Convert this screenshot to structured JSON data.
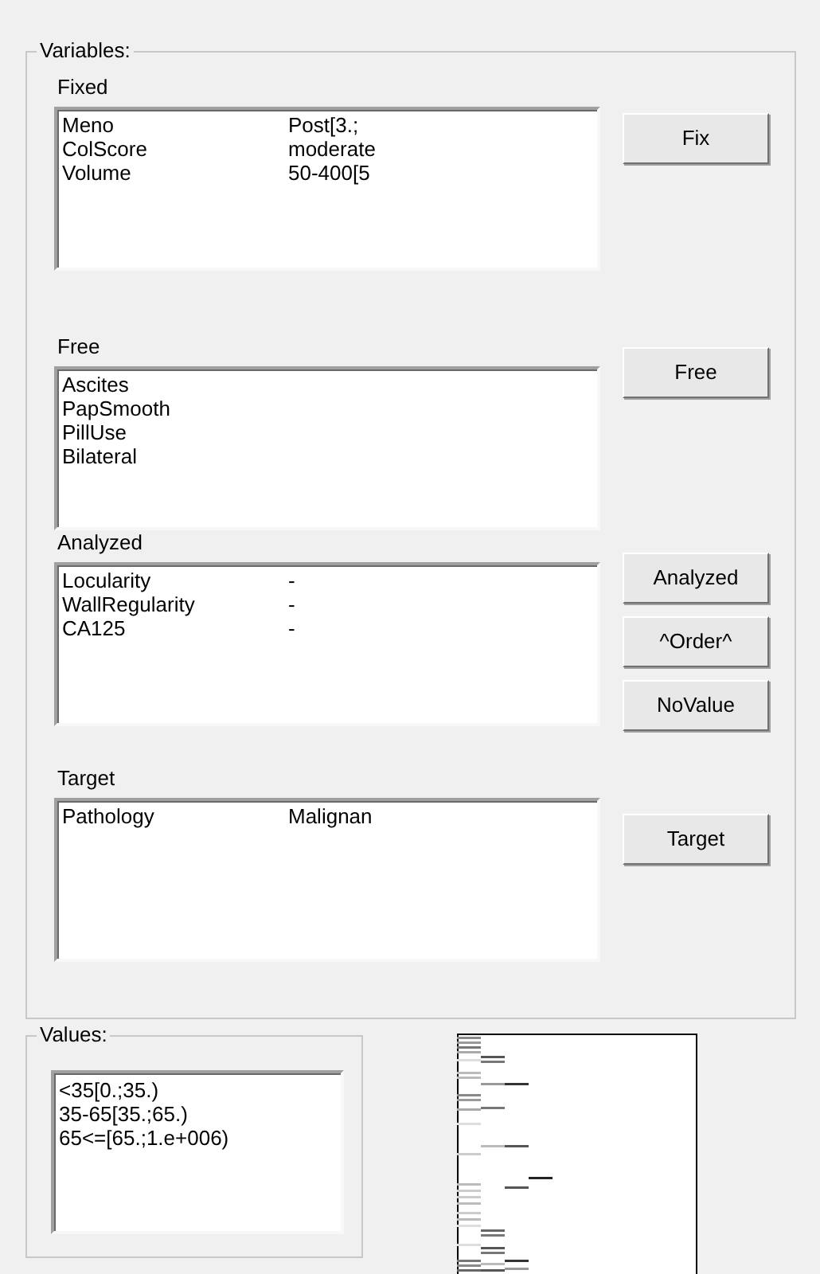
{
  "variables": {
    "title": "Variables:",
    "sections": [
      {
        "label": "Fixed",
        "rows": [
          {
            "name": "Meno",
            "value": "Post[3.;"
          },
          {
            "name": "ColScore",
            "value": "moderate"
          },
          {
            "name": "Volume",
            "value": "50-400[5"
          }
        ],
        "buttons": [
          "Fix"
        ]
      },
      {
        "label": "Free",
        "rows": [
          {
            "name": "Ascites"
          },
          {
            "name": "PapSmooth"
          },
          {
            "name": "PillUse"
          },
          {
            "name": "Bilateral"
          }
        ],
        "buttons": [
          "Free"
        ]
      },
      {
        "label": "Analyzed",
        "rows": [
          {
            "name": "Locularity",
            "value": "-"
          },
          {
            "name": "WallRegularity",
            "value": "-"
          },
          {
            "name": "CA125",
            "value": "-"
          }
        ],
        "buttons": [
          "Analyzed",
          "^Order^",
          "NoValue"
        ]
      },
      {
        "label": "Target",
        "rows": [
          {
            "name": "Pathology",
            "value": "Malignan"
          }
        ],
        "buttons": [
          "Target"
        ]
      }
    ]
  },
  "values": {
    "title": "Values:",
    "items": [
      "<35[0.;35.)",
      "35-65[35.;65.)",
      "65<=[65.;1.e+006)"
    ]
  }
}
